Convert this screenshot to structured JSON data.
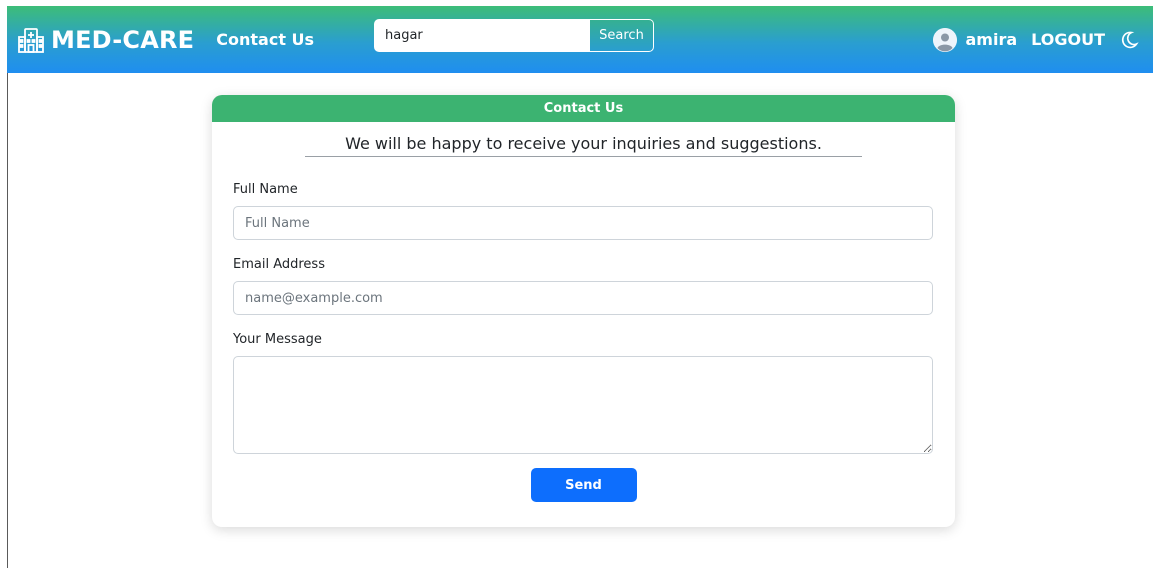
{
  "navbar": {
    "brand": "MED-CARE",
    "brand_icon": "hospital-icon",
    "contact_link": "Contact Us",
    "search": {
      "value": "hagar",
      "button_label": "Search"
    },
    "user_name": "amira",
    "logout_label": "LOGOUT",
    "theme_icon": "moon-icon"
  },
  "card": {
    "header": "Contact Us",
    "subtitle": "We will be happy to receive your inquiries and suggestions.",
    "fields": {
      "full_name": {
        "label": "Full Name",
        "placeholder": "Full Name",
        "value": ""
      },
      "email": {
        "label": "Email Address",
        "placeholder": "name@example.com",
        "value": ""
      },
      "message": {
        "label": "Your Message",
        "value": ""
      }
    },
    "send_label": "Send"
  },
  "colors": {
    "header_green": "#3cb371",
    "send_blue": "#0d6efd",
    "nav_gradient_top": "#3dbd78",
    "nav_gradient_bottom": "#1f8ef0"
  }
}
